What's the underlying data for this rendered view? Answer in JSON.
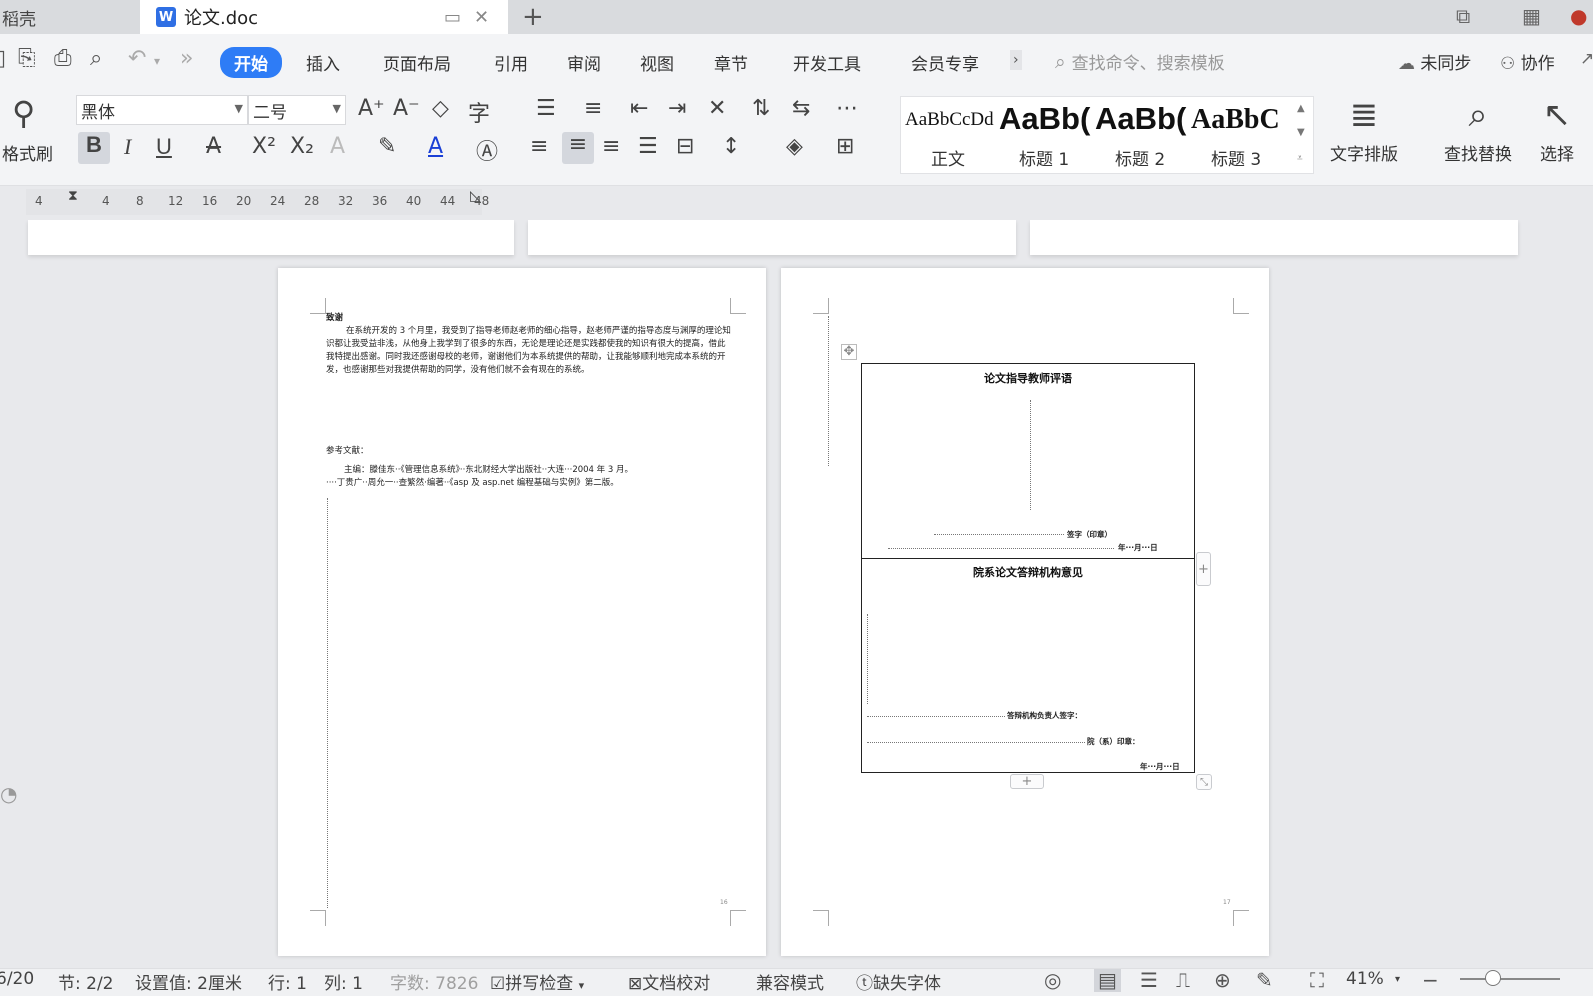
{
  "window": {
    "prev_tab_label": "稻壳",
    "doc_logo": "W",
    "doc_tab_label": "论文.doc",
    "new_tab_icon": "+"
  },
  "menu": {
    "items": [
      "开始",
      "插入",
      "页面布局",
      "引用",
      "审阅",
      "视图",
      "章节",
      "开发工具",
      "会员专享"
    ],
    "search_placeholder": "查找命令、搜索模板",
    "sync_label": "未同步",
    "collab_label": "协作"
  },
  "ribbon": {
    "format_painter_label": "格式刷",
    "font_name": "黑体",
    "font_size": "二号",
    "styles": [
      {
        "sample": "AaBbCcDd",
        "name": "正文"
      },
      {
        "sample": "AaBb(",
        "name": "标题 1"
      },
      {
        "sample": "AaBb(",
        "name": "标题 2"
      },
      {
        "sample": "AaBbC",
        "name": "标题 3"
      }
    ],
    "text_layout_label": "文字排版",
    "find_replace_label": "查找替换",
    "select_label": "选择",
    "bold_glyph": "B",
    "italic_glyph": "I",
    "underline_glyph": "U"
  },
  "ruler": {
    "ticks": [
      "4",
      "4",
      "8",
      "12",
      "16",
      "20",
      "24",
      "28",
      "32",
      "36",
      "40",
      "44",
      "48"
    ]
  },
  "page_left": {
    "heading": "致谢",
    "paragraph": "在系统开发的 3 个月里，我受到了指导老师赵老师的细心指导，赵老师严谨的指导态度与渊厚的理论知识都让我受益非浅，从他身上我学到了很多的东西，无论是理论还是实践都使我的知识有很大的提高，借此我特提出感谢。同时我还感谢母校的老师，谢谢他们为本系统提供的帮助，让我能够顺利地完成本系统的开发，也感谢那些对我提供帮助的同学，没有他们就不会有现在的系统。",
    "ref_title": "参考文献：",
    "refs": [
      "主编：滕佳东··《管理信息系统》··东北财经大学出版社··大连···2004 年 3 月。",
      "····丁贵广··周允一··查繁然·编著··《asp 及 asp.net 编程基础与实例》第二版。"
    ],
    "page_no": "16"
  },
  "page_right": {
    "table": {
      "section1_title": "论文指导教师评语",
      "sign1": "签字（印章）",
      "date1": "年···月···日",
      "section2_title": "院系论文答辩机构意见",
      "sign2": "答辩机构负责人签字：",
      "sign3": "院（系）印章：",
      "date2": "年···月···日"
    },
    "page_no": "17"
  },
  "status": {
    "page": "6/20",
    "section": "节: 2/2",
    "setting": "设置值: 2厘米",
    "row": "行: 1",
    "col": "列: 1",
    "word_count": "字数: 7826",
    "spell_check": "拼写检查",
    "proofread": "文档校对",
    "compat_mode": "兼容模式",
    "missing_font": "缺失字体",
    "zoom": "41%"
  },
  "colors": {
    "accent": "#2e7cf6",
    "doc_logo": "#2f6fe4"
  }
}
